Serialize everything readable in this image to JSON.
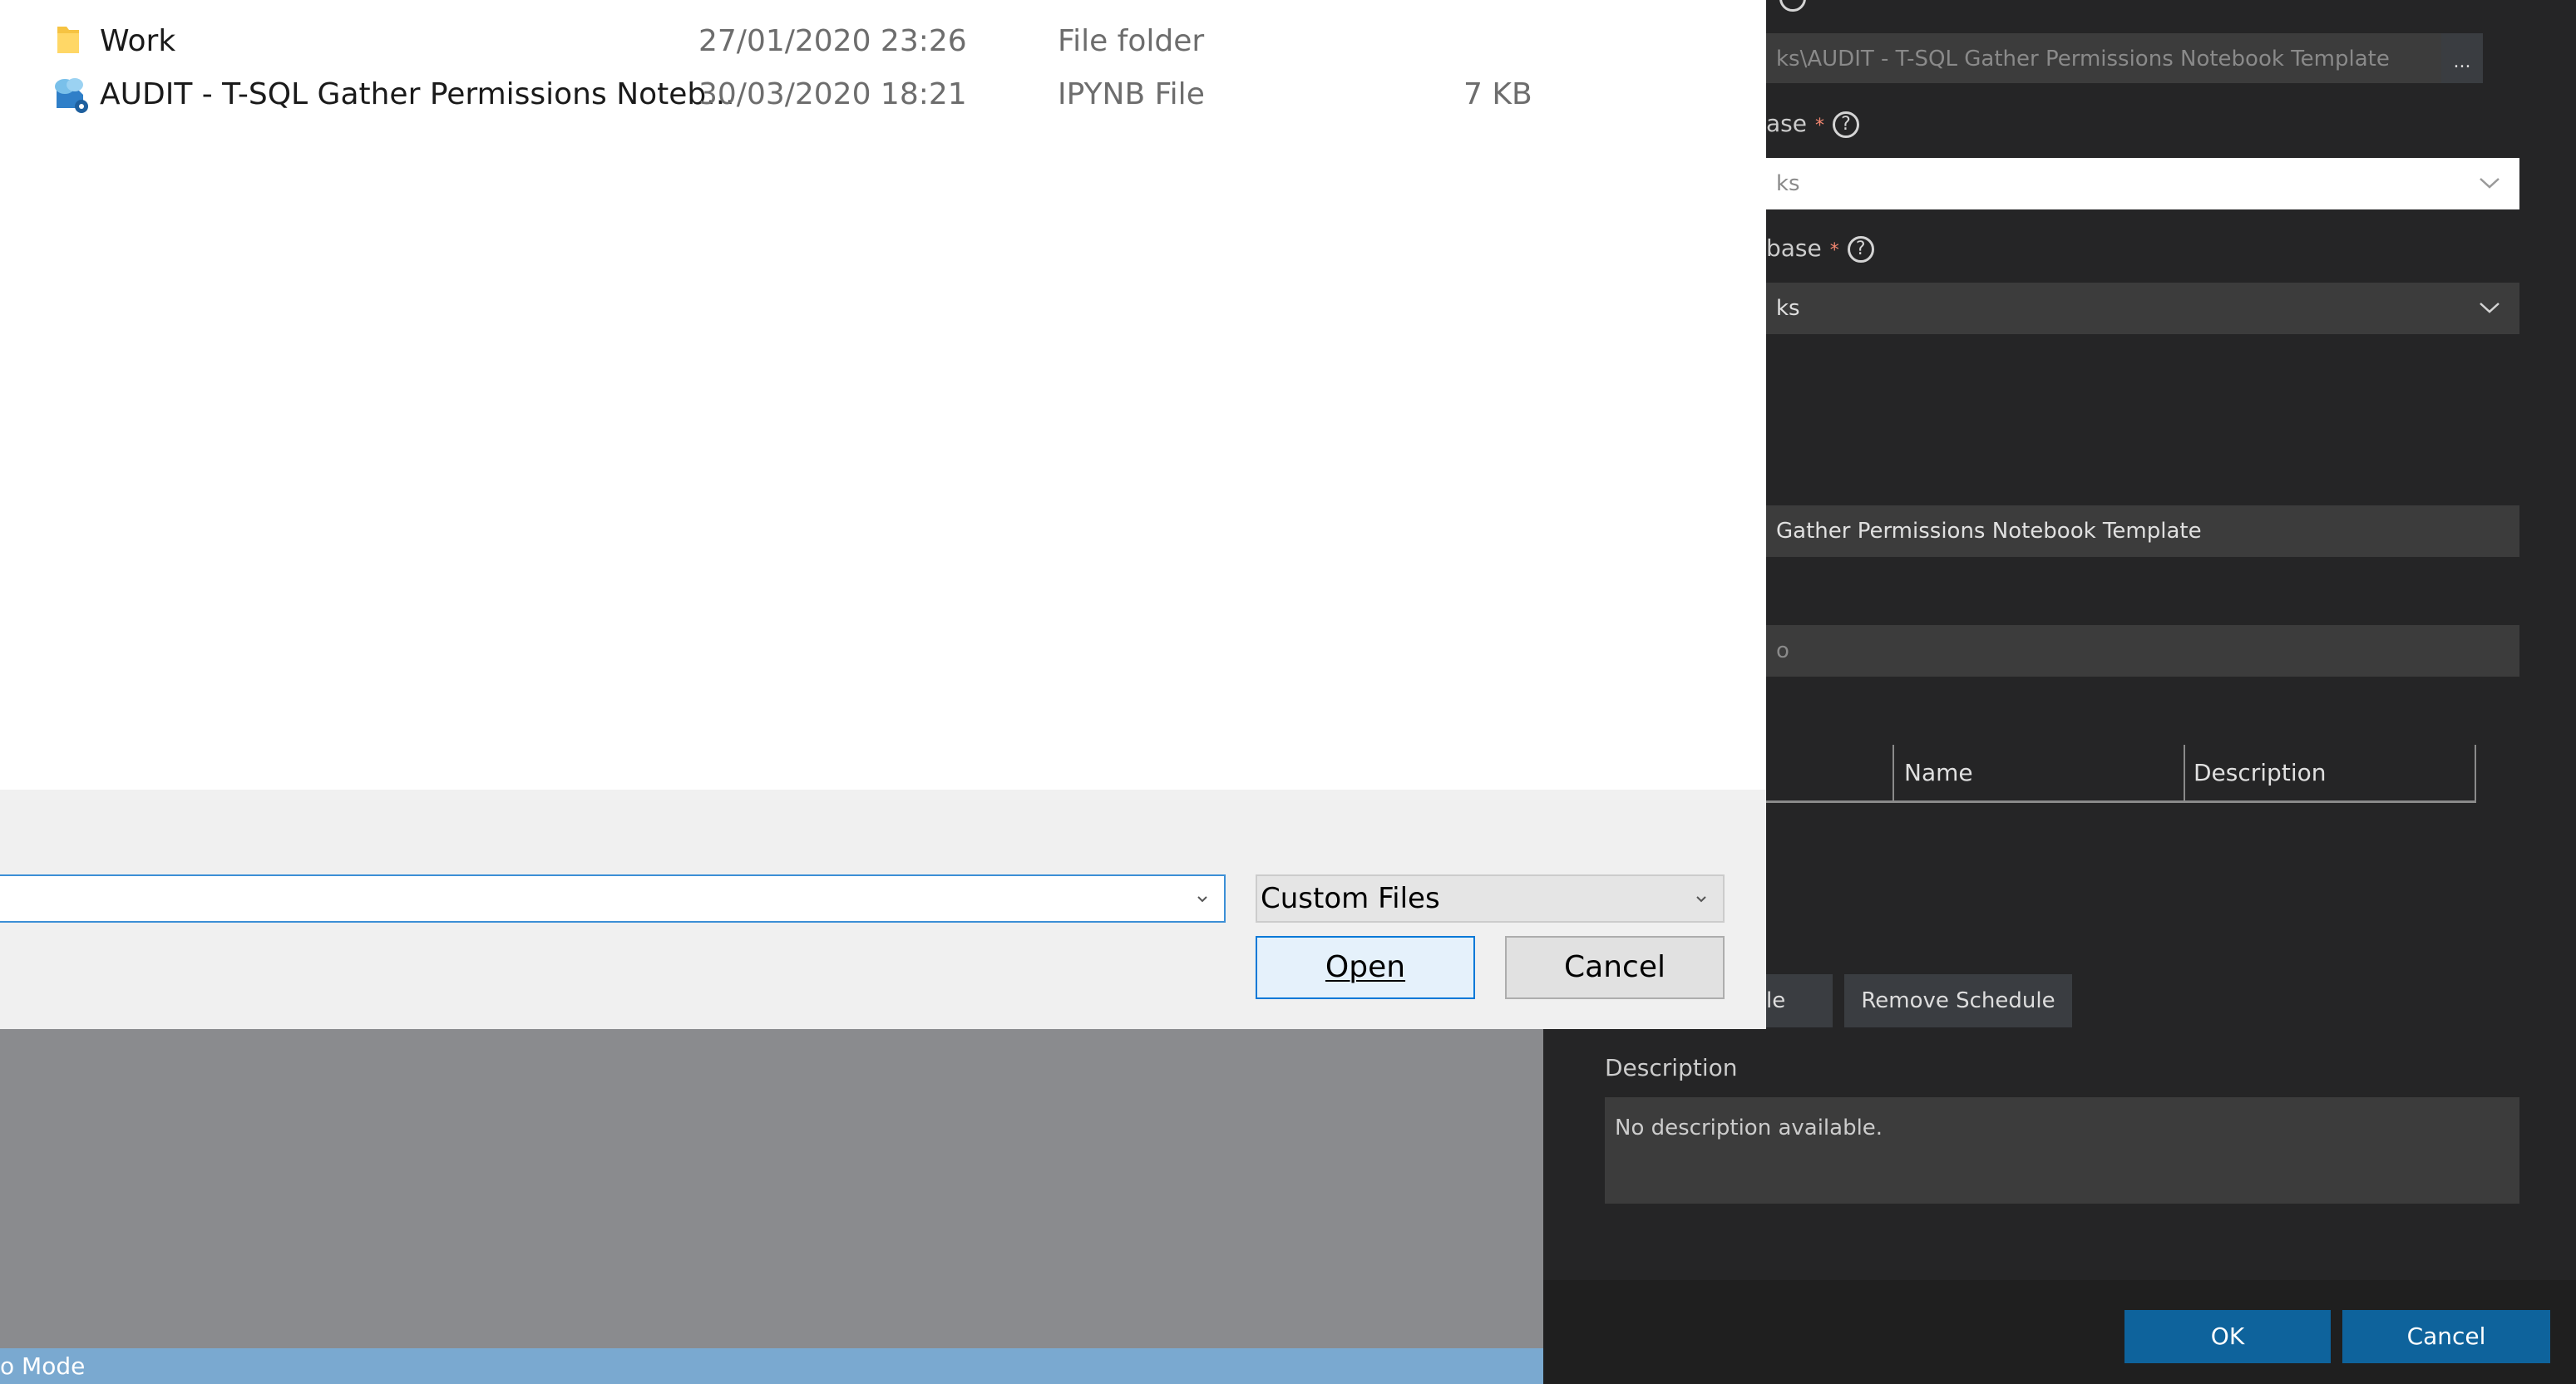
{
  "file_list": {
    "rows": [
      {
        "name": "Work",
        "date": "27/01/2020 23:26",
        "type": "File folder",
        "size": ""
      },
      {
        "name": "AUDIT - T-SQL Gather Permissions Noteb...",
        "date": "30/03/2020 18:21",
        "type": "IPYNB File",
        "size": "7 KB"
      }
    ]
  },
  "file_footer": {
    "filename_value": "",
    "filter_value": "Custom Files",
    "open_label": "Open",
    "cancel_label": "Cancel"
  },
  "background": {
    "status_text": "o Mode"
  },
  "job_dialog": {
    "path_value": "ks\\AUDIT - T-SQL Gather Permissions Notebook Template",
    "browse_label": "...",
    "database_label_1": "ase",
    "database_value_1": "ks",
    "database_label_2": "base",
    "database_value_2": "ks",
    "required_mark": "*",
    "help_glyph": "?",
    "name_value": "Gather Permissions Notebook Template",
    "owner_value": "o",
    "schedule_table": {
      "headers": [
        "",
        "Name",
        "Description"
      ]
    },
    "pick_schedule_partial": "le",
    "remove_schedule_label": "Remove Schedule",
    "description_label": "Description",
    "description_value": "No description available.",
    "ok_label": "OK",
    "cancel_label": "Cancel"
  }
}
